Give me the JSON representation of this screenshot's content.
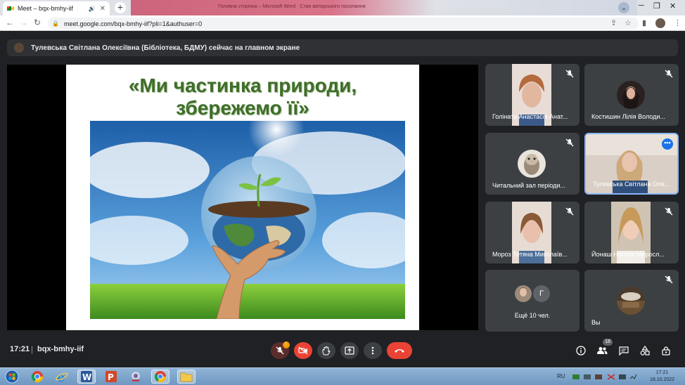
{
  "browser": {
    "tab_title": "Meet – bqx-bmhy-iif",
    "background_tab_text": "Головна сторінка – Microsoft Word · Стан авторського посилання",
    "url": "meet.google.com/bqx-bmhy-iif?pli=1&authuser=0"
  },
  "meet": {
    "presenting_banner": "Тулевська Світлана Олексіївна (Бібліотека, БДМУ) сейчас на главном экране",
    "slide_title_line1": "«Ми частинка природи,",
    "slide_title_line2": "збережемо її»",
    "participants": [
      {
        "name": "Голіната Анастасія Анат..."
      },
      {
        "name": "Костишин Лілія Володи..."
      },
      {
        "name": "Читальний зал періоди..."
      },
      {
        "name": "Тулевська Світлана Оле..."
      },
      {
        "name": "Мороз Тетяна Миколаїв..."
      },
      {
        "name": "Йонаш Наталя Миросл..."
      },
      {
        "name": "Ещё 10 чел.",
        "avatar_letter": "Г"
      },
      {
        "name": "Вы"
      }
    ],
    "bottom": {
      "time": "17:21",
      "separator": "|",
      "meeting_code": "bqx-bmhy-iif",
      "mic_badge": "!",
      "people_count": "18"
    }
  },
  "taskbar": {
    "language": "RU",
    "clock_time": "17:21",
    "clock_date": "18.10.2022"
  },
  "colors": {
    "accent": "#1a73e8",
    "danger": "#ea4335",
    "tile_bg": "#3c4043",
    "title_green": "#3f6e2a"
  }
}
